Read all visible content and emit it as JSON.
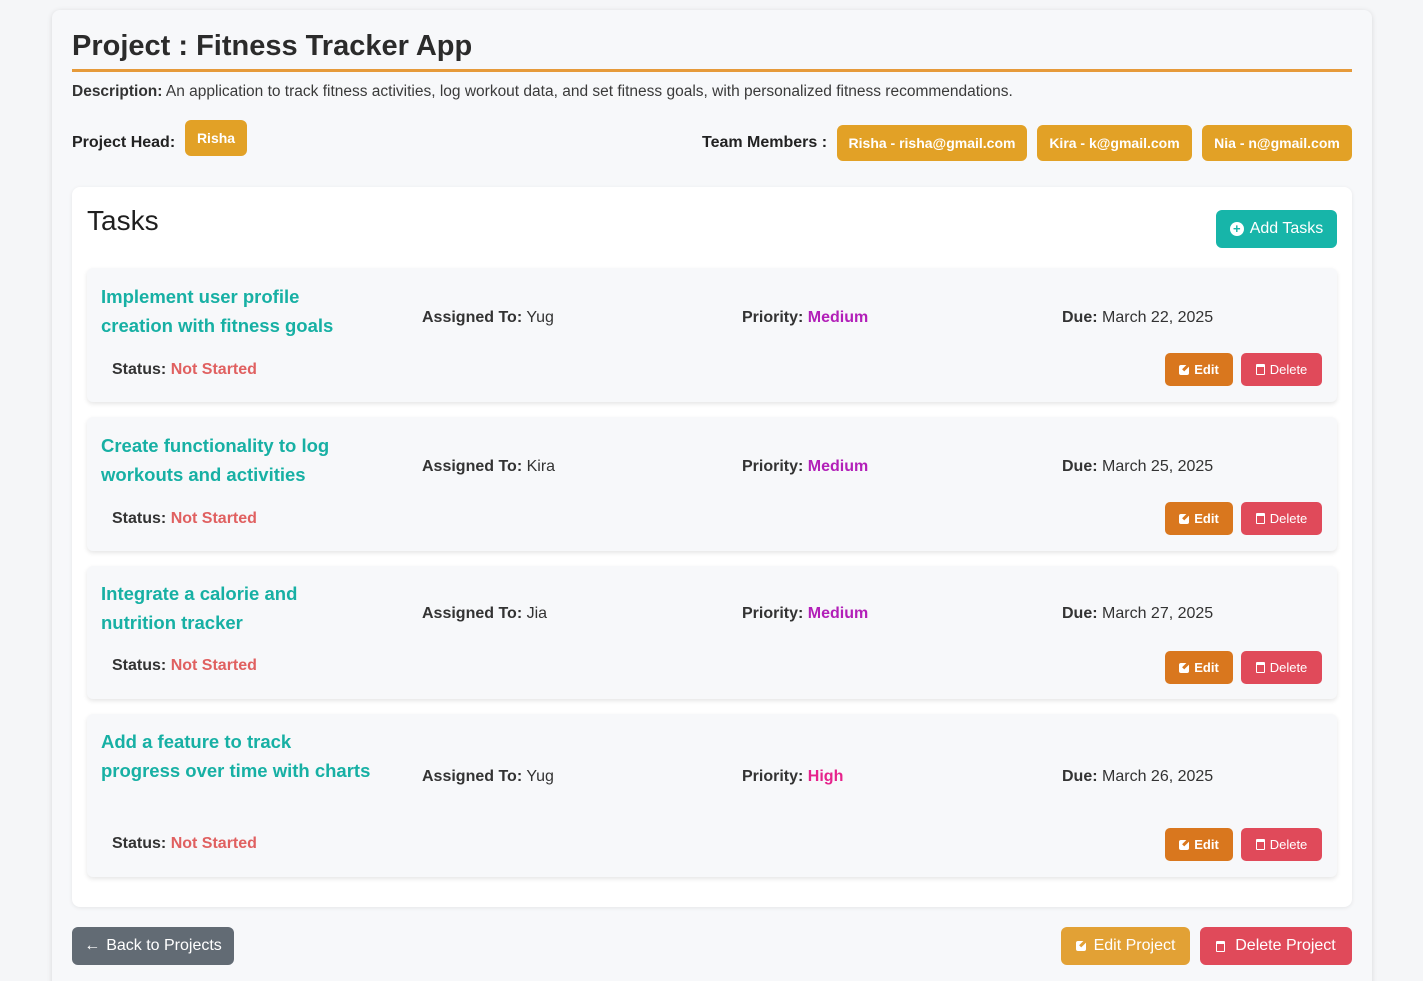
{
  "project": {
    "title": "Project : Fitness Tracker App",
    "description_label": "Description:",
    "description": "An application to track fitness activities, log workout data, and set fitness goals, with personalized fitness recommendations.",
    "head_label": "Project Head:",
    "head": "Risha",
    "team_label": "Team Members :",
    "team": [
      "Risha - risha@gmail.com",
      "Kira - k@gmail.com",
      "Nia - n@gmail.com"
    ]
  },
  "tasks_section": {
    "title": "Tasks",
    "add_label": "Add Tasks",
    "assigned_label": "Assigned To:",
    "priority_label": "Priority:",
    "due_label": "Due:",
    "status_label": "Status:",
    "edit_label": "Edit",
    "delete_label": "Delete",
    "items": [
      {
        "title": "Implement user profile creation with fitness goals",
        "assigned": "Yug",
        "priority": "Medium",
        "due": "March 22, 2025",
        "status": "Not Started"
      },
      {
        "title": "Create functionality to log workouts and activities",
        "assigned": "Kira",
        "priority": "Medium",
        "due": "March 25, 2025",
        "status": "Not Started"
      },
      {
        "title": "Integrate a calorie and nutrition tracker",
        "assigned": "Jia",
        "priority": "Medium",
        "due": "March 27, 2025",
        "status": "Not Started"
      },
      {
        "title": "Add a feature to track progress over time with charts",
        "assigned": "Yug",
        "priority": "High",
        "due": "March 26, 2025",
        "status": "Not Started"
      }
    ]
  },
  "footer": {
    "back_label": "Back to Projects",
    "edit_project_label": "Edit Project",
    "delete_project_label": "Delete Project"
  },
  "colors": {
    "accent": "#e2a126",
    "teal": "#17b5a9",
    "danger": "#e04a5a",
    "priority_medium": "#b21fb8",
    "priority_high": "#e6238c",
    "status_not_started": "#e06060"
  }
}
